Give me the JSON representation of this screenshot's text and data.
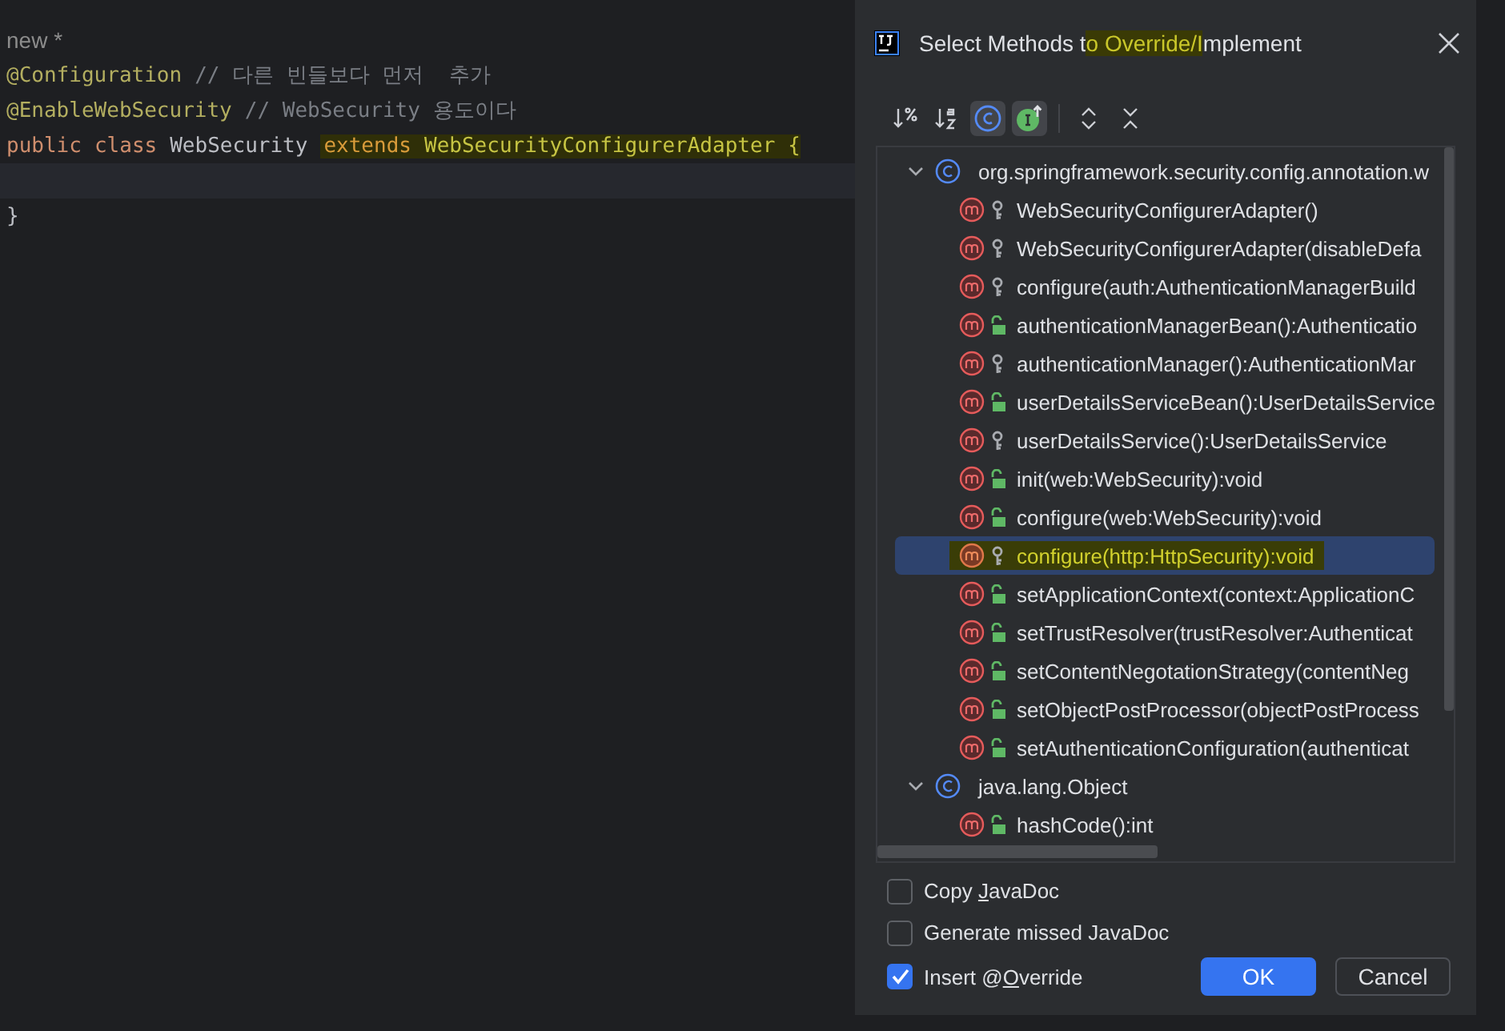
{
  "editor": {
    "lines": [
      {
        "current": false,
        "tokens": [
          {
            "text": "new *",
            "kind": "hint",
            "highlighted": false
          }
        ]
      },
      {
        "current": false,
        "tokens": [
          {
            "text": "@Configuration",
            "kind": "annotation",
            "highlighted": false
          },
          {
            "text": "// 다른 빈들보다 먼저  추가",
            "kind": "comment",
            "highlighted": false
          }
        ]
      },
      {
        "current": false,
        "tokens": [
          {
            "text": "@EnableWebSecurity",
            "kind": "annotation",
            "highlighted": false
          },
          {
            "text": "// WebSecurity 용도이다",
            "kind": "comment",
            "highlighted": false
          }
        ]
      },
      {
        "current": false,
        "tokens": [
          {
            "text": "public",
            "kind": "keyword",
            "highlighted": false
          },
          {
            "text": "class",
            "kind": "keyword",
            "highlighted": false
          },
          {
            "text": "WebSecurity",
            "kind": "plain",
            "highlighted": false
          },
          {
            "text": "extends",
            "kind": "keyword",
            "highlighted": true
          },
          {
            "text": "WebSecurityConfigurerAdapter",
            "kind": "plain",
            "highlighted": true
          },
          {
            "text": "{",
            "kind": "plain",
            "highlighted": true
          }
        ]
      },
      {
        "current": true
      },
      {
        "current": false,
        "tokens": [
          {
            "text": "}",
            "kind": "plain",
            "highlighted": false
          }
        ]
      }
    ]
  },
  "dialog": {
    "title": [
      {
        "text": "Select Methods t",
        "highlighted": false
      },
      {
        "text": "o Override/I",
        "highlighted": true
      },
      {
        "text": "mplement",
        "highlighted": false
      }
    ],
    "toolbar": [
      {
        "kind": "sort-by-visibility",
        "selected": false
      },
      {
        "kind": "sort-alphabetically",
        "selected": false
      },
      {
        "kind": "show-classes",
        "selected": true
      },
      {
        "kind": "show-interfaces",
        "selected": true
      },
      {
        "kind": "expand-all",
        "selected": false
      },
      {
        "kind": "collapse-all",
        "selected": false
      }
    ],
    "tree": [
      {
        "label": "org.springframework.security.config.annotation.w",
        "expanded": true,
        "children": [
          {
            "label": "WebSecurityConfigurerAdapter()",
            "kind": "protected",
            "selected": false,
            "highlighted": false
          },
          {
            "label": "WebSecurityConfigurerAdapter(disableDefa",
            "kind": "protected",
            "selected": false,
            "highlighted": false
          },
          {
            "label": "configure(auth:AuthenticationManagerBuild",
            "kind": "protected",
            "selected": false,
            "highlighted": false
          },
          {
            "label": "authenticationManagerBean():Authenticatio",
            "kind": "public",
            "selected": false,
            "highlighted": false
          },
          {
            "label": "authenticationManager():AuthenticationMar",
            "kind": "protected",
            "selected": false,
            "highlighted": false
          },
          {
            "label": "userDetailsServiceBean():UserDetailsService",
            "kind": "public",
            "selected": false,
            "highlighted": false
          },
          {
            "label": "userDetailsService():UserDetailsService",
            "kind": "protected",
            "selected": false,
            "highlighted": false
          },
          {
            "label": "init(web:WebSecurity):void",
            "kind": "public",
            "selected": false,
            "highlighted": false
          },
          {
            "label": "configure(web:WebSecurity):void",
            "kind": "public",
            "selected": false,
            "highlighted": false
          },
          {
            "label": "configure(http:HttpSecurity):void",
            "kind": "protected",
            "selected": true,
            "highlighted": true
          },
          {
            "label": "setApplicationContext(context:ApplicationC",
            "kind": "public",
            "selected": false,
            "highlighted": false
          },
          {
            "label": "setTrustResolver(trustResolver:Authenticat",
            "kind": "public",
            "selected": false,
            "highlighted": false
          },
          {
            "label": "setContentNegotationStrategy(contentNeg",
            "kind": "public",
            "selected": false,
            "highlighted": false
          },
          {
            "label": "setObjectPostProcessor(objectPostProcess",
            "kind": "public",
            "selected": false,
            "highlighted": false
          },
          {
            "label": "setAuthenticationConfiguration(authenticat",
            "kind": "public",
            "selected": false,
            "highlighted": false
          }
        ]
      },
      {
        "label": "java.lang.Object",
        "expanded": true,
        "children": [
          {
            "label": "hashCode():int",
            "kind": "public",
            "selected": false,
            "highlighted": false
          }
        ]
      }
    ],
    "options": [
      {
        "before": "Copy ",
        "mnemonic": "J",
        "after": "avaDoc",
        "checked": false
      },
      {
        "before": "Generate missed JavaDoc",
        "checked": false
      },
      {
        "before": "Insert @",
        "mnemonic": "O",
        "after": "verride",
        "checked": true
      }
    ],
    "buttons": [
      {
        "label": "OK",
        "kind": "primary"
      },
      {
        "label": "Cancel",
        "kind": "secondary"
      }
    ]
  }
}
